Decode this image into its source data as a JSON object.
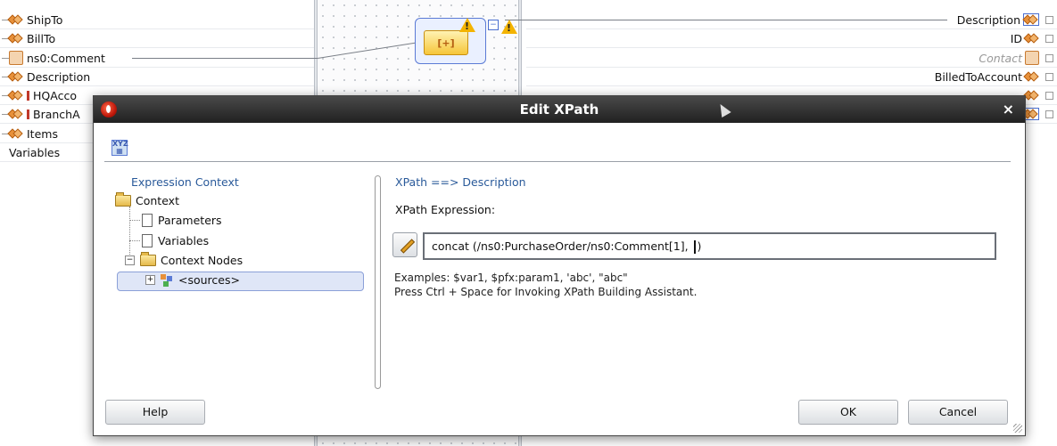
{
  "sources": [
    "ShipTo",
    "BillTo",
    "ns0:Comment",
    "Description",
    "HQAcco",
    "BranchA",
    "Items"
  ],
  "variables_label": "Variables",
  "targets": [
    "Description",
    "ID",
    "Contact",
    "BilledToAccount"
  ],
  "dialog": {
    "title": "Edit XPath",
    "close": "×",
    "context_header": "Expression Context",
    "tree": {
      "context": "Context",
      "parameters": "Parameters",
      "variables": "Variables",
      "context_nodes": "Context Nodes",
      "sources": "<sources>"
    },
    "xpath_header": "XPath ==> Description",
    "xpath_label": "XPath Expression:",
    "expression_value": "concat (/ns0:PurchaseOrder/ns0:Comment[1], ",
    "expression_tail": ")",
    "examples_line": "Examples: $var1, $pfx:param1, 'abc', \"abc\"",
    "hint_line": "Press Ctrl + Space for Invoking XPath Building Assistant.",
    "help_button": "Help",
    "ok_button": "OK",
    "cancel_button": "Cancel"
  }
}
